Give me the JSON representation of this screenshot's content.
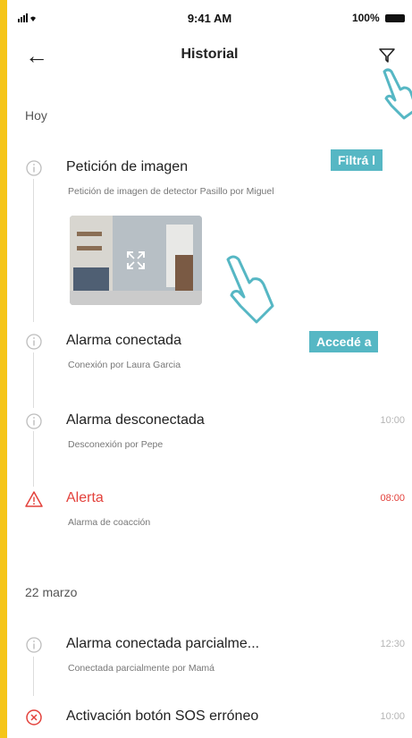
{
  "status_bar": {
    "signal": "▪ııl",
    "time": "9:41 AM",
    "battery": "100%"
  },
  "header": {
    "title": "Historial"
  },
  "sections": [
    {
      "label": "Hoy"
    },
    {
      "label": "22 marzo"
    }
  ],
  "events": [
    {
      "title": "Petición de imagen",
      "subtitle": "Petición de imagen de detector Pasillo por Miguel",
      "time": ""
    },
    {
      "title": "Alarma conectada",
      "subtitle": "Conexión por Laura Garcia",
      "time": ""
    },
    {
      "title": "Alarma desconectada",
      "subtitle": "Desconexión por Pepe",
      "time": "10:00"
    },
    {
      "title": "Alerta",
      "subtitle": "Alarma de coacción",
      "time": "08:00"
    },
    {
      "title": "Alarma conectada parcialme...",
      "subtitle": "Conectada parcialmente por Mamá",
      "time": "12:30"
    },
    {
      "title": "Activación botón SOS erróneo",
      "subtitle": "",
      "time": "10:00"
    }
  ],
  "tooltips": {
    "filter": "Filtrá l",
    "access": "Accedé a"
  },
  "colors": {
    "accent_bg": "#f5c518",
    "alert": "#e3413b",
    "tooltip": "#56b7c4"
  }
}
